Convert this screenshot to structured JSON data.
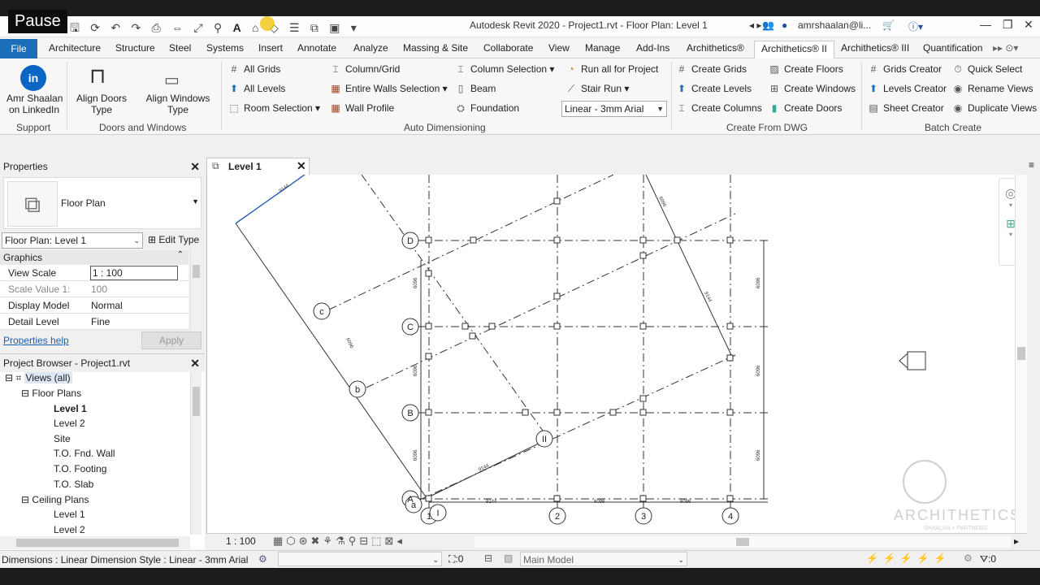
{
  "overlay": {
    "pause_label": "Pause"
  },
  "titlebar": {
    "title": "Autodesk Revit 2020 - Project1.rvt - Floor Plan: Level 1",
    "user": "amrshaalan@li..."
  },
  "tabs": [
    "File",
    "Architecture",
    "Structure",
    "Steel",
    "Systems",
    "Insert",
    "Annotate",
    "Analyze",
    "Massing & Site",
    "Collaborate",
    "View",
    "Manage",
    "Add-Ins",
    "Archithetics®",
    "Archithetics® II",
    "Archithetics® III",
    "Quantification"
  ],
  "ribbon": {
    "support": {
      "button": "Amr Shaalan on LinkedIn",
      "btn_line1": "Amr Shaalan",
      "btn_line2": "on LinkedIn",
      "label": "Support"
    },
    "doors_windows": {
      "align_doors_1": "Align Doors",
      "align_doors_2": "Type",
      "align_windows_1": "Align Windows",
      "align_windows_2": "Type",
      "label": "Doors and Windows"
    },
    "auto_dim": {
      "all_grids": "All Grids",
      "all_levels": "All Levels",
      "room_selection": "Room Selection",
      "column_grid": "Column/Grid",
      "entire_walls": "Entire Walls Selection",
      "wall_profile": "Wall Profile",
      "column_selection": "Column Selection",
      "beam": "Beam",
      "foundation": "Foundation",
      "run_all": "Run all for Project",
      "stair_run": "Stair Run",
      "dim_style": "Linear - 3mm Arial",
      "label": "Auto Dimensioning"
    },
    "dwg": {
      "create_grids": "Create Grids",
      "create_levels": "Create Levels",
      "create_columns": "Create Columns",
      "create_floors": "Create Floors",
      "create_windows": "Create Windows",
      "create_doors": "Create Doors",
      "label": "Create From DWG"
    },
    "batch": {
      "grids_creator": "Grids Creator",
      "levels_creator": "Levels Creator",
      "sheet_creator": "Sheet Creator",
      "quick_select": "Quick Select",
      "rename_views": "Rename Views",
      "duplicate_views": "Duplicate Views",
      "label": "Batch Create"
    }
  },
  "properties": {
    "title": "Properties",
    "type": "Floor Plan",
    "selector": "Floor Plan: Level 1",
    "edit_type": "Edit Type",
    "section": "Graphics",
    "rows": [
      {
        "k": "View Scale",
        "v": "1 : 100"
      },
      {
        "k": "Scale Value    1:",
        "v": "100"
      },
      {
        "k": "Display Model",
        "v": "Normal"
      },
      {
        "k": "Detail Level",
        "v": "Fine"
      }
    ],
    "help": "Properties help",
    "apply": "Apply"
  },
  "browser": {
    "title": "Project Browser - Project1.rvt",
    "items": [
      "Views (all)",
      "Floor Plans",
      "Level 1",
      "Level 2",
      "Site",
      "T.O. Fnd. Wall",
      "T.O. Footing",
      "T.O. Slab",
      "Ceiling Plans",
      "Level 1",
      "Level 2"
    ]
  },
  "view": {
    "tab": "Level 1",
    "scale": "1 : 100",
    "grid_bubbles_h": [
      "D",
      "C",
      "B",
      "A"
    ],
    "grid_bubbles_v": [
      "1",
      "2",
      "3",
      "4"
    ],
    "rot_bubbles": [
      "c",
      "b",
      "a",
      "I",
      "II"
    ],
    "dims": [
      "9144",
      "9144",
      "9144",
      "6096",
      "6096",
      "6096",
      "6096",
      "6096",
      "6096",
      "6096",
      "6096",
      "9144",
      "6096",
      "6096"
    ],
    "watermark": "ARCHITHETICS",
    "watermark_sub": "SHAALAN + PARTNERS"
  },
  "status": {
    "text": "Dimensions : Linear Dimension Style : Linear - 3mm Arial",
    "sel_count": ":0",
    "model": "Main Model",
    "filter": ":0"
  }
}
